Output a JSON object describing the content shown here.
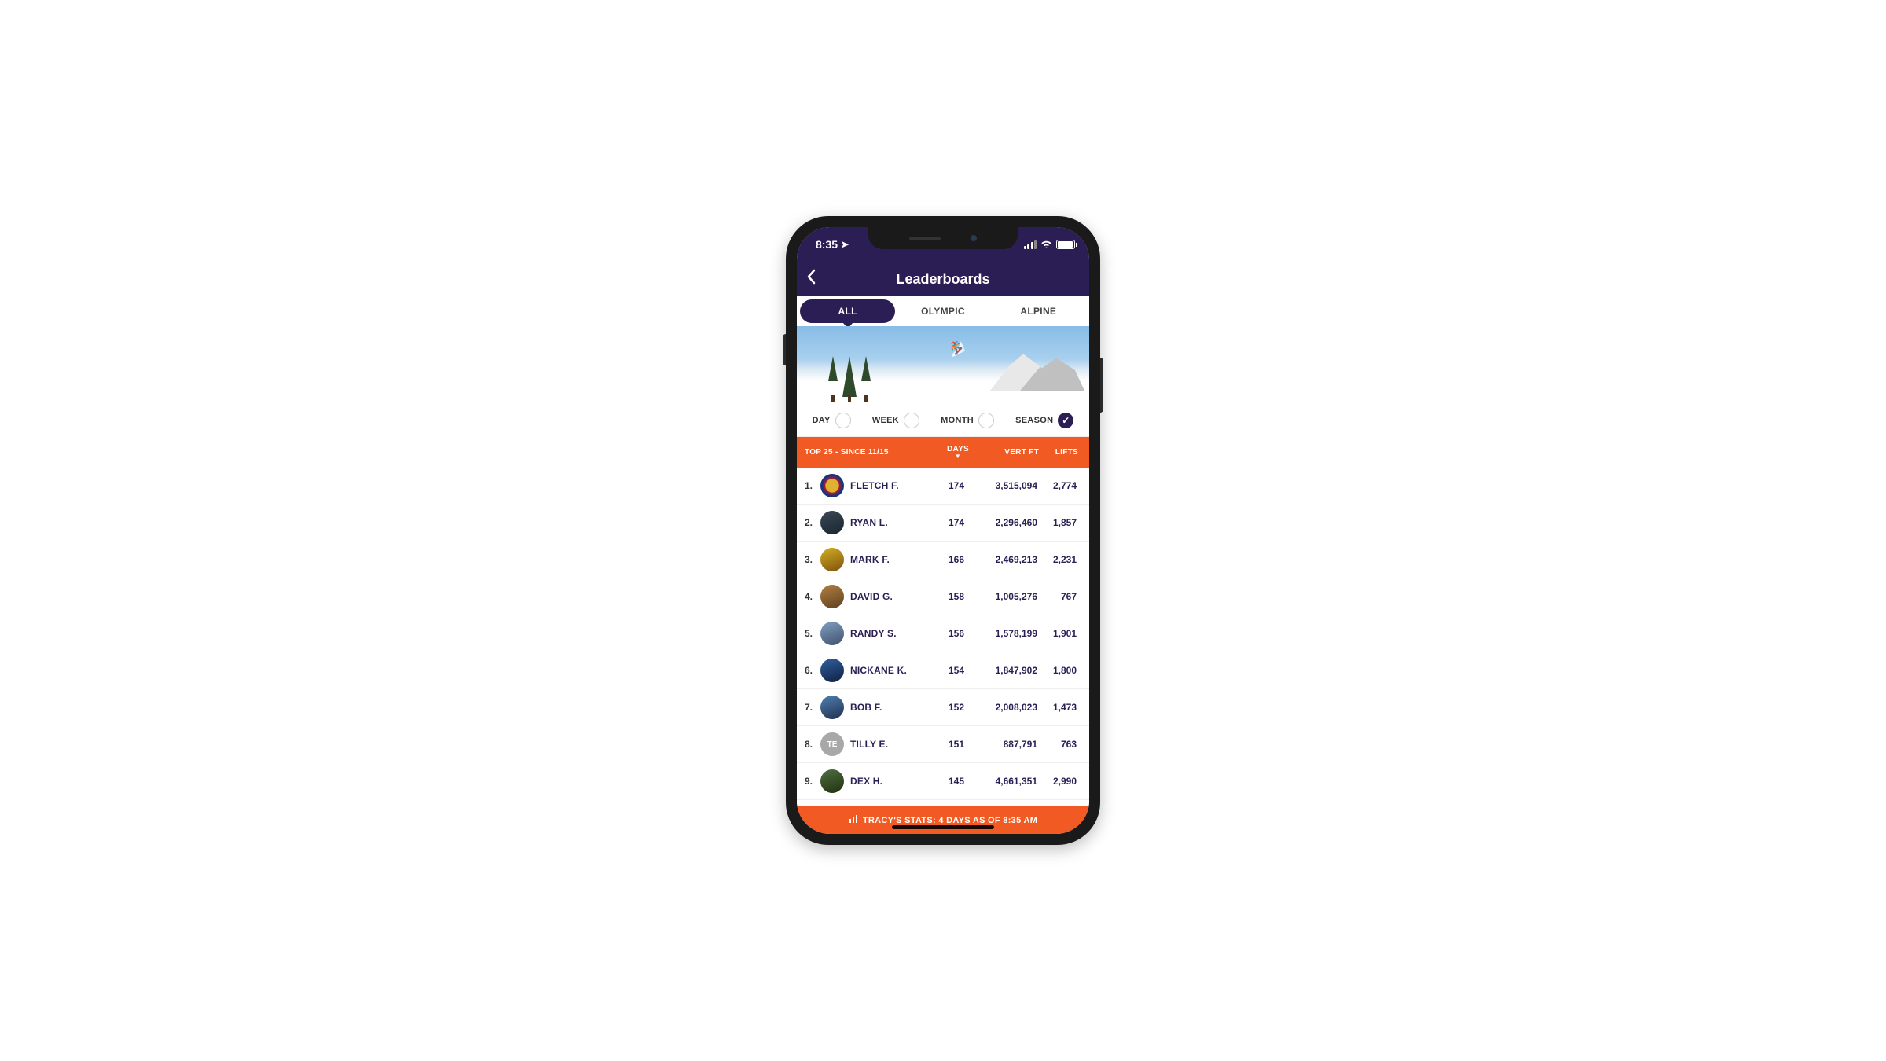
{
  "statusbar": {
    "time": "8:35"
  },
  "navbar": {
    "title": "Leaderboards"
  },
  "tabs": [
    {
      "label": "ALL",
      "active": true
    },
    {
      "label": "OLYMPIC",
      "active": false
    },
    {
      "label": "ALPINE",
      "active": false
    }
  ],
  "filters": [
    {
      "label": "DAY",
      "checked": false
    },
    {
      "label": "WEEK",
      "checked": false
    },
    {
      "label": "MONTH",
      "checked": false
    },
    {
      "label": "SEASON",
      "checked": true
    }
  ],
  "table": {
    "title": "TOP 25 - SINCE 11/15",
    "columns": {
      "days": "DAYS",
      "vert": "VERT FT",
      "lifts": "LIFTS"
    },
    "sort_column": "days",
    "rows": [
      {
        "rank": "1.",
        "name": "FLETCH F.",
        "days": "174",
        "vert": "3,515,094",
        "lifts": "2,774",
        "avatar_bg": "radial-gradient(circle,#e0b030 40%,#b02020 42%,#203080 60%)",
        "initials": ""
      },
      {
        "rank": "2.",
        "name": "RYAN L.",
        "days": "174",
        "vert": "2,296,460",
        "lifts": "1,857",
        "avatar_bg": "linear-gradient(160deg,#3a4a55,#1a2530)",
        "initials": ""
      },
      {
        "rank": "3.",
        "name": "MARK F.",
        "days": "166",
        "vert": "2,469,213",
        "lifts": "2,231",
        "avatar_bg": "linear-gradient(160deg,#d0b020,#805010)",
        "initials": ""
      },
      {
        "rank": "4.",
        "name": "DAVID G.",
        "days": "158",
        "vert": "1,005,276",
        "lifts": "767",
        "avatar_bg": "linear-gradient(160deg,#b08040,#604020)",
        "initials": ""
      },
      {
        "rank": "5.",
        "name": "RANDY S.",
        "days": "156",
        "vert": "1,578,199",
        "lifts": "1,901",
        "avatar_bg": "linear-gradient(160deg,#80a0c0,#405070)",
        "initials": ""
      },
      {
        "rank": "6.",
        "name": "NICKANE K.",
        "days": "154",
        "vert": "1,847,902",
        "lifts": "1,800",
        "avatar_bg": "linear-gradient(160deg,#3060a0,#102040)",
        "initials": ""
      },
      {
        "rank": "7.",
        "name": "BOB F.",
        "days": "152",
        "vert": "2,008,023",
        "lifts": "1,473",
        "avatar_bg": "linear-gradient(160deg,#5080b0,#203050)",
        "initials": ""
      },
      {
        "rank": "8.",
        "name": "TILLY E.",
        "days": "151",
        "vert": "887,791",
        "lifts": "763",
        "avatar_bg": "#a8a8a8",
        "initials": "TE"
      },
      {
        "rank": "9.",
        "name": "DEX H.",
        "days": "145",
        "vert": "4,661,351",
        "lifts": "2,990",
        "avatar_bg": "linear-gradient(160deg,#507040,#203010)",
        "initials": ""
      }
    ]
  },
  "footer": {
    "text": "TRACY'S STATS: 4 DAYS AS OF 8:35 AM"
  }
}
